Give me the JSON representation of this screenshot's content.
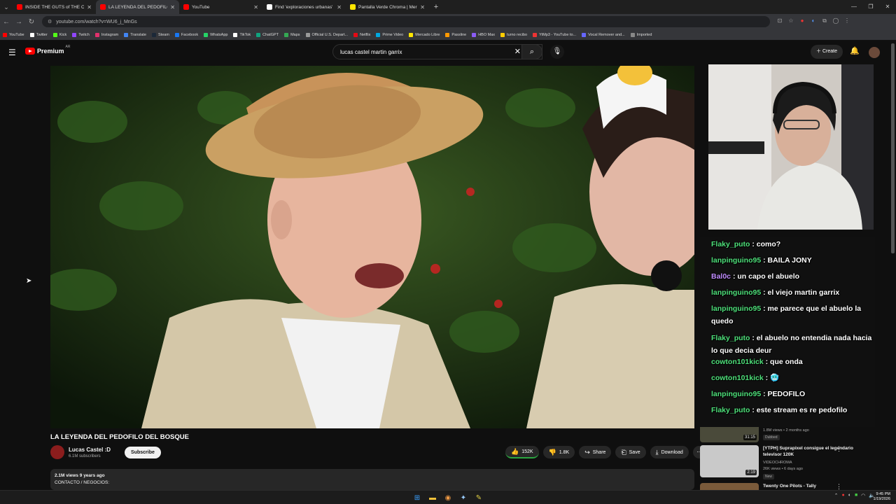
{
  "browser": {
    "tabs": [
      {
        "title": "INSIDE THE GUTS of THE CRAZ",
        "color": "#ff0000",
        "active": false
      },
      {
        "title": "LA LEYENDA DEL PEDOFILO",
        "color": "#ff0000",
        "active": true
      },
      {
        "title": "YouTube",
        "color": "#ff0000",
        "active": false
      },
      {
        "title": "Find 'exploraciones urbanas' o",
        "color": "#ffffff",
        "active": false
      },
      {
        "title": "Pantalla Verde Chroma | Merca",
        "color": "#ffe600",
        "active": false
      }
    ],
    "url": "youtube.com/watch?v=WU6_j_MnGs",
    "bookmarks": [
      "YouTube",
      "Twitter",
      "Kick",
      "Twitch",
      "Instagram",
      "Translate",
      "Steam",
      "Facebook",
      "WhatsApp",
      "TikTok",
      "ChatGPT",
      "Maps",
      "Official U.S. Depart...",
      "Netflix",
      "Prime Video",
      "Mercado Libre",
      "Passline",
      "HBO Max",
      "turno recibo",
      "YtMp3 - YouTube to...",
      "Vocal Remover and...",
      "Imported"
    ]
  },
  "youtube": {
    "logo_text": "Premium",
    "logo_region": "AR",
    "search_query": "lucas castel martin garrix",
    "create_label": "Create"
  },
  "video": {
    "title": "LA LEYENDA DEL PEDOFILO DEL BOSQUE",
    "channel": "Lucas Castel :D",
    "subscribers": "6.1M subscribers",
    "subscribe_label": "Subscribe",
    "likes": "152K",
    "dislikes": "1.8K",
    "share_label": "Share",
    "save_label": "Save",
    "download_label": "Download",
    "views_line": "2.1M views  9 years ago",
    "desc_line": "CONTACTO / NEGOCIOS:"
  },
  "chat": [
    {
      "user": "Flaky_puto",
      "color": "#4ee07a",
      "text": ": como?"
    },
    {
      "user": "lanpinguino95",
      "color": "#4ee07a",
      "text": ": BAILA JONY"
    },
    {
      "user": "Bal0c",
      "color": "#c08cff",
      "text": ": un capo el abuelo"
    },
    {
      "user": "lanpinguino95",
      "color": "#4ee07a",
      "text": ": el viejo martin garrix"
    },
    {
      "user": "lanpinguino95",
      "color": "#4ee07a",
      "text": ": me parece que el abuelo la quedo"
    },
    {
      "user": "Flaky_puto",
      "color": "#4ee07a",
      "text": ": el abuelo no entendia nada hacia lo que decia deur"
    },
    {
      "user": "cowton101kick",
      "color": "#4ee07a",
      "text": ": que onda"
    },
    {
      "user": "cowton101kick",
      "color": "#4ee07a",
      "text": ": 🥶"
    },
    {
      "user": "lanpinguino95",
      "color": "#4ee07a",
      "text": ": PEDOFILO"
    },
    {
      "user": "Flaky_puto",
      "color": "#4ee07a",
      "text": ": este stream es re pedofilo"
    }
  ],
  "recommendations": [
    {
      "title": "",
      "meta1": "1.8M views • 2 months ago",
      "badge": "Dubbed",
      "duration": "31:15"
    },
    {
      "title": "[YTPH] Suprapixel consigue el legendario televisor 120K",
      "meta1": "VIDEOCHROMA",
      "meta2": "26K views • 6 days ago",
      "badge": "New",
      "duration": "2:19"
    },
    {
      "title": "Twenty One Pilots - Tally",
      "meta1": "",
      "badge": "",
      "duration": ""
    }
  ],
  "clock": {
    "time": "9:45 PM",
    "date": "1/19/2026"
  }
}
